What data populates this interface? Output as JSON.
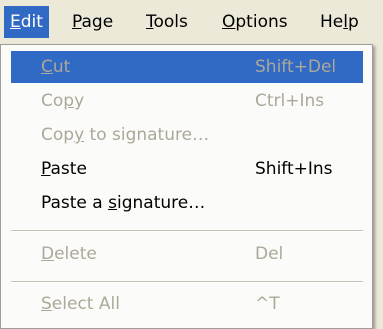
{
  "menubar": {
    "items": [
      {
        "label_pre": "",
        "mnemonic": "E",
        "label_post": "dit"
      },
      {
        "label_pre": "",
        "mnemonic": "P",
        "label_post": "age"
      },
      {
        "label_pre": "",
        "mnemonic": "T",
        "label_post": "ools"
      },
      {
        "label_pre": "",
        "mnemonic": "O",
        "label_post": "ptions"
      },
      {
        "label_pre": "He",
        "mnemonic": "l",
        "label_post": "p"
      }
    ]
  },
  "edit_menu": {
    "items": [
      {
        "label_pre": "",
        "mnemonic": "C",
        "label_post": "ut",
        "shortcut": "Shift+Del",
        "enabled": false,
        "highlighted": true
      },
      {
        "label_pre": "Co",
        "mnemonic": "p",
        "label_post": "y",
        "shortcut": "Ctrl+Ins",
        "enabled": false
      },
      {
        "label_pre": "Cop",
        "mnemonic": "y",
        "label_post": " to signature…",
        "shortcut": "",
        "enabled": false
      },
      {
        "label_pre": "",
        "mnemonic": "P",
        "label_post": "aste",
        "shortcut": "Shift+Ins",
        "enabled": true
      },
      {
        "label_pre": "Paste a ",
        "mnemonic": "s",
        "label_post": "ignature…",
        "shortcut": "",
        "enabled": true
      },
      {
        "label_pre": "",
        "mnemonic": "D",
        "label_post": "elete",
        "shortcut": "Del",
        "enabled": false
      },
      {
        "label_pre": "",
        "mnemonic": "S",
        "label_post": "elect All",
        "shortcut": "^T",
        "enabled": false
      }
    ]
  },
  "colors": {
    "highlight": "#316ac5",
    "menu_background": "#fbfbf9",
    "disabled_text": "#aca899",
    "bar_background": "#ece9d8"
  }
}
